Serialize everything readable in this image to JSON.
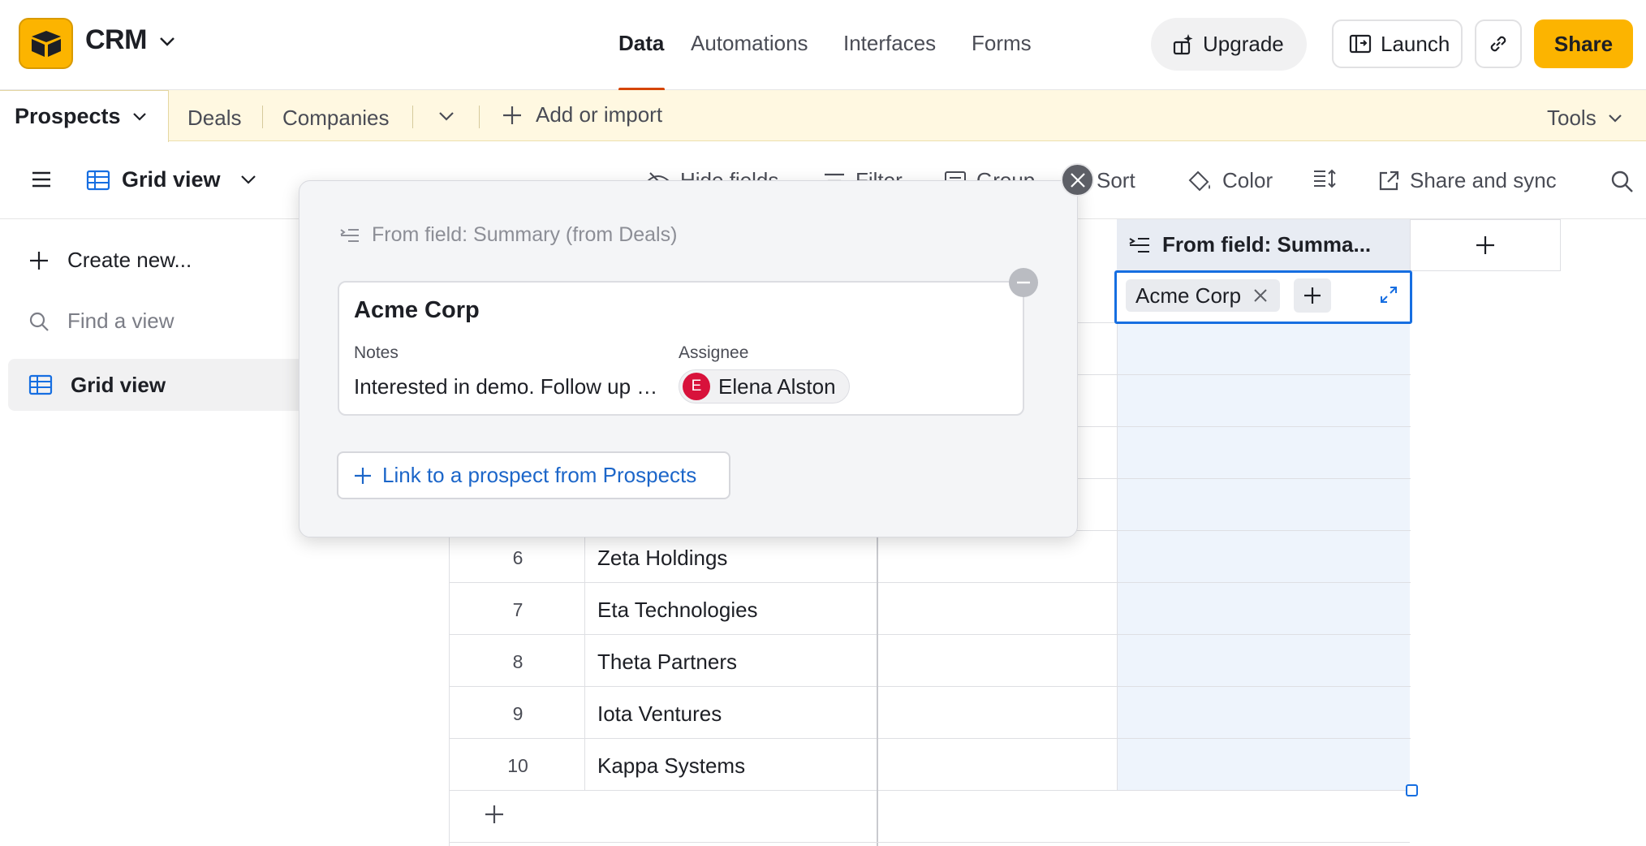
{
  "header": {
    "base_name": "CRM",
    "nav": {
      "data": "Data",
      "automations": "Automations",
      "interfaces": "Interfaces",
      "forms": "Forms"
    },
    "upgrade_label": "Upgrade",
    "launch_label": "Launch",
    "share_label": "Share",
    "accent_color": "#fcb400"
  },
  "tables": {
    "active": "Prospects",
    "others": [
      "Deals",
      "Companies"
    ],
    "add_import_label": "Add or import",
    "tools_label": "Tools"
  },
  "toolbar": {
    "view_name": "Grid view",
    "hide_fields": "Hide fields",
    "filter": "Filter",
    "group": "Group",
    "sort": "Sort",
    "color": "Color",
    "share_sync": "Share and sync"
  },
  "sidebar": {
    "create_new": "Create new...",
    "find_placeholder": "Find a view",
    "views": [
      "Grid view"
    ]
  },
  "grid": {
    "column_header": "From field: Summa...",
    "rows": [
      {
        "num": "6",
        "name": "Zeta Holdings"
      },
      {
        "num": "7",
        "name": "Eta Technologies"
      },
      {
        "num": "8",
        "name": "Theta Partners"
      },
      {
        "num": "9",
        "name": "Iota Ventures"
      },
      {
        "num": "10",
        "name": "Kappa Systems"
      }
    ],
    "active_cell_value": "Acme Corp"
  },
  "popover": {
    "title": "From field: Summary (from Deals)",
    "record": {
      "name": "Acme Corp",
      "notes_label": "Notes",
      "notes_value": "Interested in demo. Follow up next week.",
      "assignee_label": "Assignee",
      "assignee_name": "Elena Alston",
      "assignee_initial": "E",
      "assignee_color": "#d8123b"
    },
    "link_button": "Link to a prospect from Prospects"
  }
}
